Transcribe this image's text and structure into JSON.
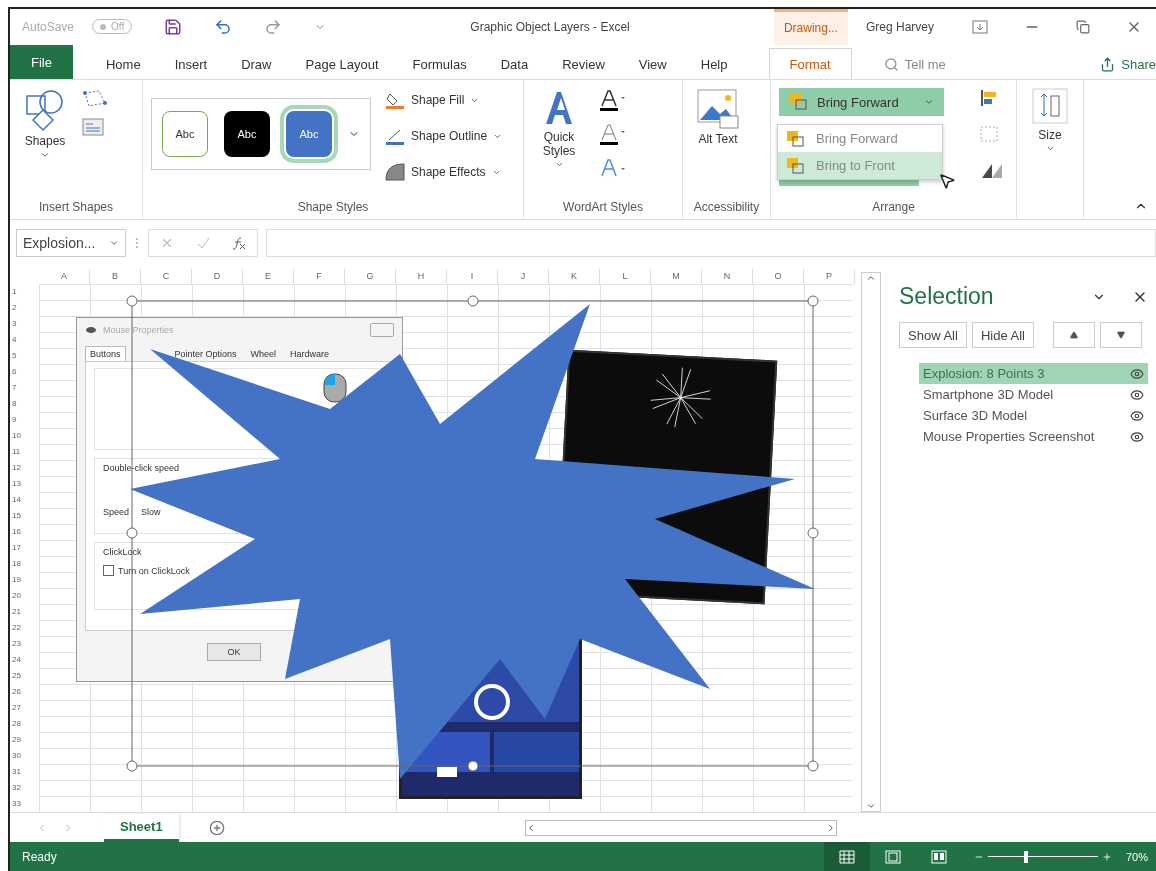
{
  "title_bar": {
    "autosave_label": "AutoSave",
    "autosave": {
      "label": "Off",
      "on": false
    },
    "title": "Graphic Object Layers  -  Excel",
    "context_tab": "Drawing...",
    "user": "Greg Harvey"
  },
  "tabs": [
    {
      "label": "File",
      "kind": "file",
      "selected": false
    },
    {
      "label": "Home",
      "kind": "tab",
      "selected": false
    },
    {
      "label": "Insert",
      "kind": "tab",
      "selected": false
    },
    {
      "label": "Draw",
      "kind": "tab",
      "selected": false
    },
    {
      "label": "Page Layout",
      "kind": "tab",
      "selected": false
    },
    {
      "label": "Formulas",
      "kind": "tab",
      "selected": false
    },
    {
      "label": "Data",
      "kind": "tab",
      "selected": false
    },
    {
      "label": "Review",
      "kind": "tab",
      "selected": false
    },
    {
      "label": "View",
      "kind": "tab",
      "selected": false
    },
    {
      "label": "Help",
      "kind": "tab",
      "selected": false
    },
    {
      "label": "Format",
      "kind": "tab",
      "selected": true
    }
  ],
  "tell_me": {
    "placeholder": "Tell me"
  },
  "share": "Share",
  "ribbon": {
    "insert_shapes": {
      "label": "Insert Shapes",
      "shapes": "Shapes"
    },
    "shape_styles": {
      "label": "Shape Styles",
      "swatches": [
        {
          "text": "Abc",
          "kind": "outline",
          "selected": false
        },
        {
          "text": "Abc",
          "kind": "dark",
          "selected": false
        },
        {
          "text": "Abc",
          "kind": "blue",
          "selected": true
        }
      ],
      "commands": [
        "Shape Fill",
        "Shape Outline",
        "Shape Effects"
      ]
    },
    "wordart": {
      "label": "WordArt Styles",
      "quick_styles": "Quick Styles"
    },
    "accessibility": {
      "label": "Accessibility",
      "alt_text": "Alt Text"
    },
    "arrange": {
      "label": "Arrange",
      "bring_forward": "Bring Forward",
      "menu": [
        {
          "label": "Bring Forward",
          "selected": false
        },
        {
          "label": "Bring to Front",
          "selected": true
        }
      ]
    },
    "size": {
      "label": "Size"
    }
  },
  "formula_bar": {
    "name_box": "Explosion..."
  },
  "sheet": {
    "columns": [
      "A",
      "B",
      "C",
      "D",
      "E",
      "F",
      "G",
      "H",
      "I",
      "J",
      "K",
      "L",
      "M",
      "N",
      "O",
      "P"
    ],
    "rows": [
      "1",
      "2",
      "3",
      "4",
      "5",
      "6",
      "7",
      "8",
      "9",
      "10",
      "11",
      "12",
      "13",
      "14",
      "15",
      "16",
      "17",
      "18",
      "19",
      "20",
      "21",
      "22",
      "23",
      "24",
      "25",
      "26",
      "27",
      "28",
      "29",
      "30",
      "31",
      "32",
      "33"
    ]
  },
  "mouse_dialog": {
    "title": "Mouse Properties",
    "tabs": [
      {
        "label": "Buttons",
        "selected": true
      },
      {
        "label": "Pointer Options",
        "selected": false
      },
      {
        "label": "Wheel",
        "selected": false
      },
      {
        "label": "Hardware",
        "selected": false
      }
    ],
    "speed_group": "Double-click speed",
    "speed_label": "Speed",
    "slow_label": "Slow",
    "clicklock_group": "ClickLock",
    "clicklock": {
      "label": "Turn on ClickLock",
      "checked": false
    },
    "ok": "OK"
  },
  "selection_pane": {
    "title": "Selection",
    "show_all": "Show All",
    "hide_all": "Hide All",
    "items": [
      {
        "label": "Explosion: 8 Points 3",
        "selected": true,
        "visible": true
      },
      {
        "label": "Smartphone 3D Model",
        "selected": false,
        "visible": true
      },
      {
        "label": "Surface 3D Model",
        "selected": false,
        "visible": true
      },
      {
        "label": "Mouse Properties Screenshot",
        "selected": false,
        "visible": true
      }
    ]
  },
  "sheet_tabs": [
    {
      "label": "Sheet1",
      "selected": true
    }
  ],
  "status_bar": {
    "status": "Ready",
    "views": [
      {
        "kind": "normal",
        "selected": true
      },
      {
        "kind": "page_layout",
        "selected": false
      },
      {
        "kind": "page_break",
        "selected": false
      }
    ],
    "zoom": {
      "level": 0.33,
      "reading": "70%"
    }
  }
}
